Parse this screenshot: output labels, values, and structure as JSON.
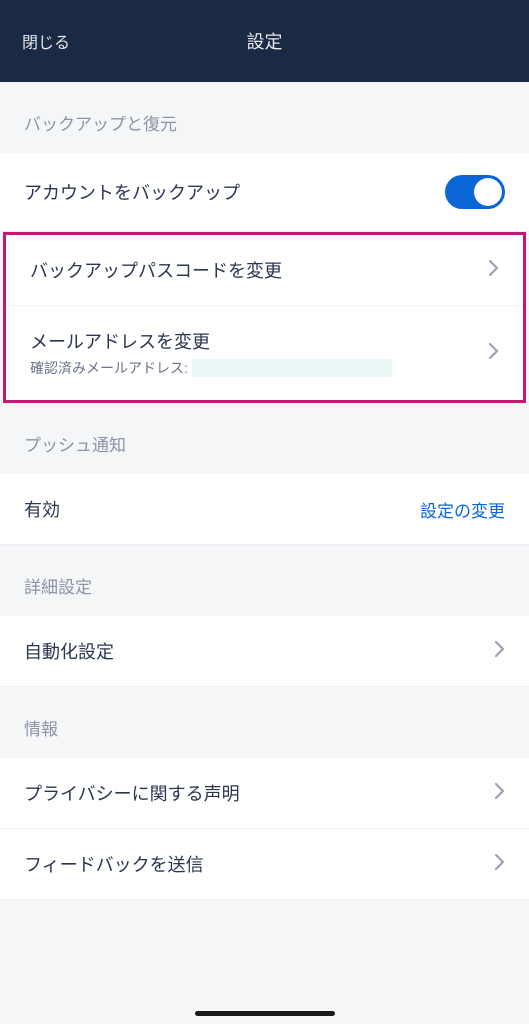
{
  "header": {
    "close_label": "閉じる",
    "title": "設定"
  },
  "sections": {
    "backup_restore": {
      "title": "バックアップと復元",
      "account_backup_label": "アカウントをバックアップ",
      "change_passcode_label": "バックアップパスコードを変更",
      "change_email_label": "メールアドレスを変更",
      "verified_email_prefix": "確認済みメールアドレス:"
    },
    "push": {
      "title": "プッシュ通知",
      "enabled_label": "有効",
      "change_settings_label": "設定の変更"
    },
    "advanced": {
      "title": "詳細設定",
      "automation_label": "自動化設定"
    },
    "info": {
      "title": "情報",
      "privacy_label": "プライバシーに関する声明",
      "feedback_label": "フィードバックを送信"
    }
  }
}
